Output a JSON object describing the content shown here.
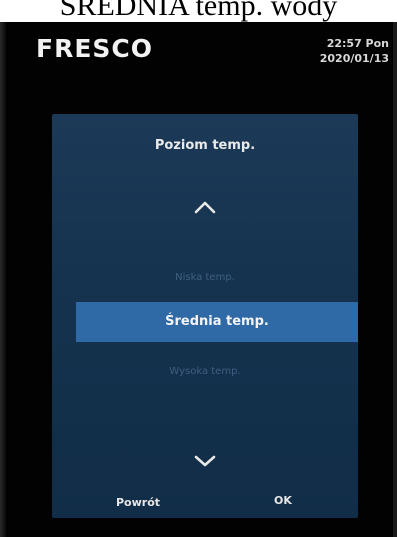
{
  "caption": "ŚREDNIA temp. wody",
  "header": {
    "brand": "FRESCO",
    "time_line": "22:57  Pon",
    "date_line": "2020/01/13"
  },
  "menu": {
    "title": "Poziom temp.",
    "up_icon": "chevron-up-icon",
    "down_icon": "chevron-down-icon",
    "options": [
      {
        "label": "Niska temp.",
        "selected": false
      },
      {
        "label": "Średnia temp.",
        "selected": true
      },
      {
        "label": "Wysoka temp.",
        "selected": false
      }
    ]
  },
  "footer": {
    "back_label": "Powrót",
    "ok_label": "OK"
  },
  "colors": {
    "panel": "#15334f",
    "selected_row": "#2f6aa7",
    "dim_text": "#3f5f80",
    "bezel": "#020202"
  }
}
